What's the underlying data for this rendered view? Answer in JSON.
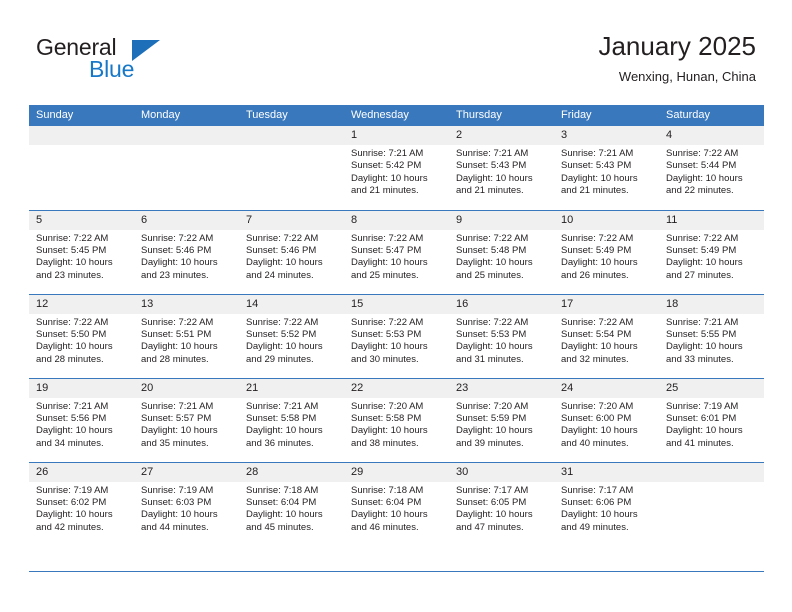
{
  "brand": {
    "name_part1": "General",
    "name_part2": "Blue",
    "logo_icon": "triangle-flag-icon",
    "accent_color": "#1878c8"
  },
  "header": {
    "title": "January 2025",
    "subtitle": "Wenxing, Hunan, China"
  },
  "theme": {
    "header_row_color": "#3a78bd",
    "daynum_band_color": "#f0f0f0",
    "text_color": "#231f20"
  },
  "weekdays": [
    "Sunday",
    "Monday",
    "Tuesday",
    "Wednesday",
    "Thursday",
    "Friday",
    "Saturday"
  ],
  "labels": {
    "sunrise_prefix": "Sunrise:",
    "sunset_prefix": "Sunset:",
    "daylight_prefix": "Daylight:"
  },
  "weeks": [
    [
      {
        "day": "",
        "sunrise": "",
        "sunset": "",
        "daylight_line1": "",
        "daylight_line2": ""
      },
      {
        "day": "",
        "sunrise": "",
        "sunset": "",
        "daylight_line1": "",
        "daylight_line2": ""
      },
      {
        "day": "",
        "sunrise": "",
        "sunset": "",
        "daylight_line1": "",
        "daylight_line2": ""
      },
      {
        "day": "1",
        "sunrise": "Sunrise: 7:21 AM",
        "sunset": "Sunset: 5:42 PM",
        "daylight_line1": "Daylight: 10 hours",
        "daylight_line2": "and 21 minutes."
      },
      {
        "day": "2",
        "sunrise": "Sunrise: 7:21 AM",
        "sunset": "Sunset: 5:43 PM",
        "daylight_line1": "Daylight: 10 hours",
        "daylight_line2": "and 21 minutes."
      },
      {
        "day": "3",
        "sunrise": "Sunrise: 7:21 AM",
        "sunset": "Sunset: 5:43 PM",
        "daylight_line1": "Daylight: 10 hours",
        "daylight_line2": "and 21 minutes."
      },
      {
        "day": "4",
        "sunrise": "Sunrise: 7:22 AM",
        "sunset": "Sunset: 5:44 PM",
        "daylight_line1": "Daylight: 10 hours",
        "daylight_line2": "and 22 minutes."
      }
    ],
    [
      {
        "day": "5",
        "sunrise": "Sunrise: 7:22 AM",
        "sunset": "Sunset: 5:45 PM",
        "daylight_line1": "Daylight: 10 hours",
        "daylight_line2": "and 23 minutes."
      },
      {
        "day": "6",
        "sunrise": "Sunrise: 7:22 AM",
        "sunset": "Sunset: 5:46 PM",
        "daylight_line1": "Daylight: 10 hours",
        "daylight_line2": "and 23 minutes."
      },
      {
        "day": "7",
        "sunrise": "Sunrise: 7:22 AM",
        "sunset": "Sunset: 5:46 PM",
        "daylight_line1": "Daylight: 10 hours",
        "daylight_line2": "and 24 minutes."
      },
      {
        "day": "8",
        "sunrise": "Sunrise: 7:22 AM",
        "sunset": "Sunset: 5:47 PM",
        "daylight_line1": "Daylight: 10 hours",
        "daylight_line2": "and 25 minutes."
      },
      {
        "day": "9",
        "sunrise": "Sunrise: 7:22 AM",
        "sunset": "Sunset: 5:48 PM",
        "daylight_line1": "Daylight: 10 hours",
        "daylight_line2": "and 25 minutes."
      },
      {
        "day": "10",
        "sunrise": "Sunrise: 7:22 AM",
        "sunset": "Sunset: 5:49 PM",
        "daylight_line1": "Daylight: 10 hours",
        "daylight_line2": "and 26 minutes."
      },
      {
        "day": "11",
        "sunrise": "Sunrise: 7:22 AM",
        "sunset": "Sunset: 5:49 PM",
        "daylight_line1": "Daylight: 10 hours",
        "daylight_line2": "and 27 minutes."
      }
    ],
    [
      {
        "day": "12",
        "sunrise": "Sunrise: 7:22 AM",
        "sunset": "Sunset: 5:50 PM",
        "daylight_line1": "Daylight: 10 hours",
        "daylight_line2": "and 28 minutes."
      },
      {
        "day": "13",
        "sunrise": "Sunrise: 7:22 AM",
        "sunset": "Sunset: 5:51 PM",
        "daylight_line1": "Daylight: 10 hours",
        "daylight_line2": "and 28 minutes."
      },
      {
        "day": "14",
        "sunrise": "Sunrise: 7:22 AM",
        "sunset": "Sunset: 5:52 PM",
        "daylight_line1": "Daylight: 10 hours",
        "daylight_line2": "and 29 minutes."
      },
      {
        "day": "15",
        "sunrise": "Sunrise: 7:22 AM",
        "sunset": "Sunset: 5:53 PM",
        "daylight_line1": "Daylight: 10 hours",
        "daylight_line2": "and 30 minutes."
      },
      {
        "day": "16",
        "sunrise": "Sunrise: 7:22 AM",
        "sunset": "Sunset: 5:53 PM",
        "daylight_line1": "Daylight: 10 hours",
        "daylight_line2": "and 31 minutes."
      },
      {
        "day": "17",
        "sunrise": "Sunrise: 7:22 AM",
        "sunset": "Sunset: 5:54 PM",
        "daylight_line1": "Daylight: 10 hours",
        "daylight_line2": "and 32 minutes."
      },
      {
        "day": "18",
        "sunrise": "Sunrise: 7:21 AM",
        "sunset": "Sunset: 5:55 PM",
        "daylight_line1": "Daylight: 10 hours",
        "daylight_line2": "and 33 minutes."
      }
    ],
    [
      {
        "day": "19",
        "sunrise": "Sunrise: 7:21 AM",
        "sunset": "Sunset: 5:56 PM",
        "daylight_line1": "Daylight: 10 hours",
        "daylight_line2": "and 34 minutes."
      },
      {
        "day": "20",
        "sunrise": "Sunrise: 7:21 AM",
        "sunset": "Sunset: 5:57 PM",
        "daylight_line1": "Daylight: 10 hours",
        "daylight_line2": "and 35 minutes."
      },
      {
        "day": "21",
        "sunrise": "Sunrise: 7:21 AM",
        "sunset": "Sunset: 5:58 PM",
        "daylight_line1": "Daylight: 10 hours",
        "daylight_line2": "and 36 minutes."
      },
      {
        "day": "22",
        "sunrise": "Sunrise: 7:20 AM",
        "sunset": "Sunset: 5:58 PM",
        "daylight_line1": "Daylight: 10 hours",
        "daylight_line2": "and 38 minutes."
      },
      {
        "day": "23",
        "sunrise": "Sunrise: 7:20 AM",
        "sunset": "Sunset: 5:59 PM",
        "daylight_line1": "Daylight: 10 hours",
        "daylight_line2": "and 39 minutes."
      },
      {
        "day": "24",
        "sunrise": "Sunrise: 7:20 AM",
        "sunset": "Sunset: 6:00 PM",
        "daylight_line1": "Daylight: 10 hours",
        "daylight_line2": "and 40 minutes."
      },
      {
        "day": "25",
        "sunrise": "Sunrise: 7:19 AM",
        "sunset": "Sunset: 6:01 PM",
        "daylight_line1": "Daylight: 10 hours",
        "daylight_line2": "and 41 minutes."
      }
    ],
    [
      {
        "day": "26",
        "sunrise": "Sunrise: 7:19 AM",
        "sunset": "Sunset: 6:02 PM",
        "daylight_line1": "Daylight: 10 hours",
        "daylight_line2": "and 42 minutes."
      },
      {
        "day": "27",
        "sunrise": "Sunrise: 7:19 AM",
        "sunset": "Sunset: 6:03 PM",
        "daylight_line1": "Daylight: 10 hours",
        "daylight_line2": "and 44 minutes."
      },
      {
        "day": "28",
        "sunrise": "Sunrise: 7:18 AM",
        "sunset": "Sunset: 6:04 PM",
        "daylight_line1": "Daylight: 10 hours",
        "daylight_line2": "and 45 minutes."
      },
      {
        "day": "29",
        "sunrise": "Sunrise: 7:18 AM",
        "sunset": "Sunset: 6:04 PM",
        "daylight_line1": "Daylight: 10 hours",
        "daylight_line2": "and 46 minutes."
      },
      {
        "day": "30",
        "sunrise": "Sunrise: 7:17 AM",
        "sunset": "Sunset: 6:05 PM",
        "daylight_line1": "Daylight: 10 hours",
        "daylight_line2": "and 47 minutes."
      },
      {
        "day": "31",
        "sunrise": "Sunrise: 7:17 AM",
        "sunset": "Sunset: 6:06 PM",
        "daylight_line1": "Daylight: 10 hours",
        "daylight_line2": "and 49 minutes."
      },
      {
        "day": "",
        "sunrise": "",
        "sunset": "",
        "daylight_line1": "",
        "daylight_line2": ""
      }
    ]
  ]
}
